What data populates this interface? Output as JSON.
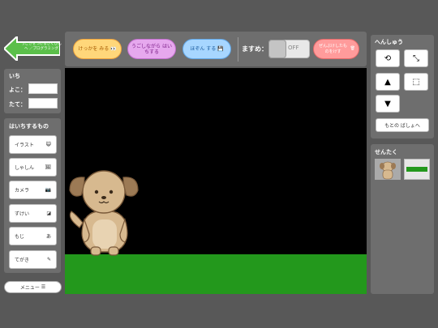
{
  "nav": {
    "back_label": "うごきをつけるさくひんへ ／プログラミング"
  },
  "toolbar": {
    "result_label": "けっかを みる",
    "move_label": "うごしながら はいちする",
    "save_label": "ほぞん する",
    "grid_label": "ますめ：",
    "grid_toggle": "OFF",
    "clear_label": "ぜんぶけしたものをけす"
  },
  "position": {
    "title": "いち",
    "x_label": "よこ：",
    "y_label": "たて：",
    "x_value": "",
    "y_value": ""
  },
  "place": {
    "title": "はいちするもの",
    "items": [
      {
        "label": "イラスト",
        "icon": "face-icon"
      },
      {
        "label": "しゃしん",
        "icon": "photo-icon"
      },
      {
        "label": "カメラ",
        "icon": "camera-icon"
      },
      {
        "label": "ずけい",
        "icon": "shapes-icon"
      },
      {
        "label": "もじ",
        "icon": "text-icon"
      },
      {
        "label": "てがき",
        "icon": "pencil-icon"
      }
    ]
  },
  "menu_label": "メニュー",
  "edit": {
    "title": "へんしゅう",
    "back_bg_label": "もとの ばしょへ"
  },
  "select": {
    "title": "せんたく"
  },
  "colors": {
    "ground": "#23981c",
    "stage": "#000000",
    "accent_green": "#5bbf4a"
  }
}
